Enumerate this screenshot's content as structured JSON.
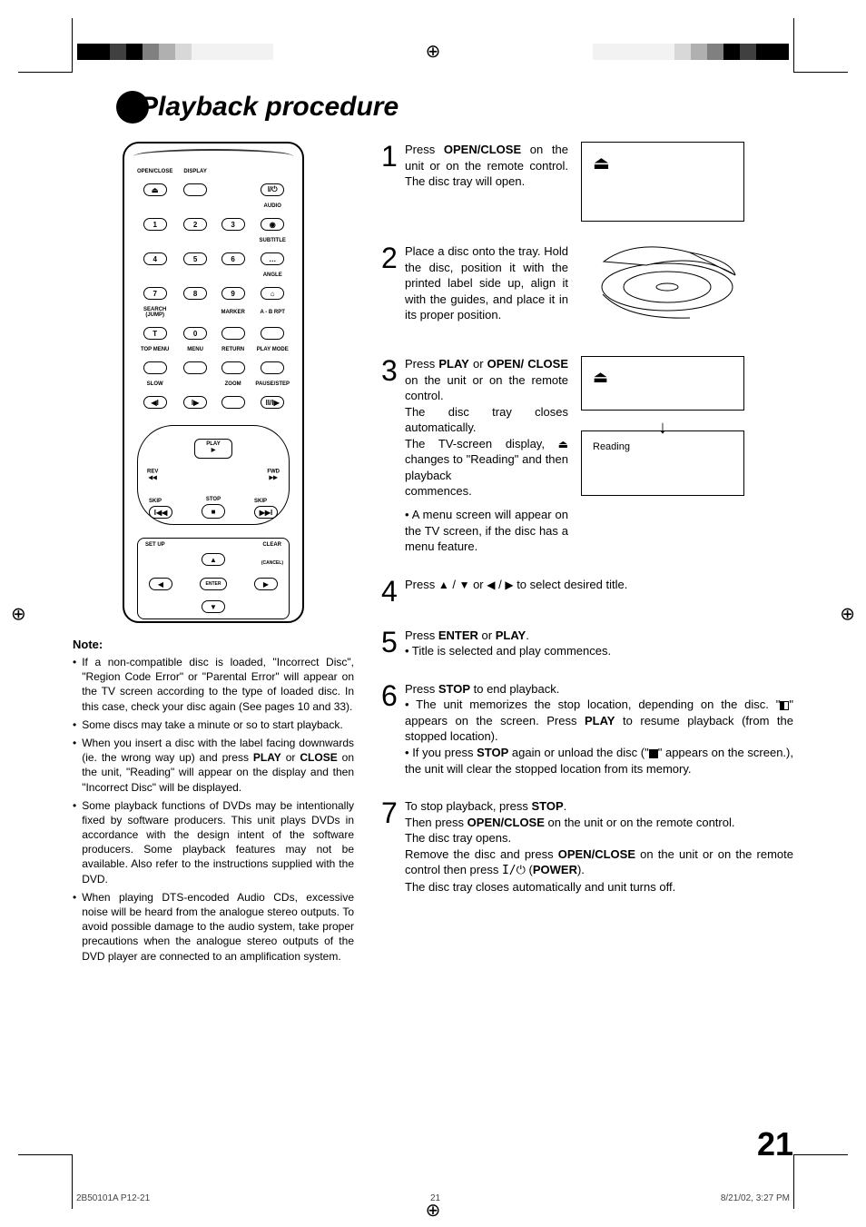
{
  "title": "Playback procedure",
  "page_number": "21",
  "footer": {
    "left": "2B50101A P12-21",
    "center": "21",
    "right": "8/21/02, 3:27 PM"
  },
  "remote": {
    "row1_labels": [
      "OPEN/CLOSE",
      "DISPLAY",
      "",
      ""
    ],
    "row2_labels": [
      "",
      "",
      "",
      "AUDIO"
    ],
    "nums_row1": [
      "1",
      "2",
      "3"
    ],
    "row3_labels": [
      "",
      "",
      "",
      "SUBTITLE"
    ],
    "nums_row2": [
      "4",
      "5",
      "6"
    ],
    "row4_labels": [
      "",
      "",
      "",
      "ANGLE"
    ],
    "nums_row3": [
      "7",
      "8",
      "9"
    ],
    "row5_labels": [
      "SEARCH (JUMP)",
      "",
      "MARKER",
      "A - B RPT"
    ],
    "nums_row4": [
      "T",
      "0"
    ],
    "row6_labels": [
      "TOP MENU",
      "MENU",
      "RETURN",
      "PLAY MODE"
    ],
    "row7_labels": [
      "SLOW",
      "",
      "ZOOM",
      "PAUSE/STEP"
    ],
    "play": "PLAY",
    "rev": "REV",
    "fwd": "FWD",
    "skip_l": "SKIP",
    "skip_r": "SKIP",
    "stop": "STOP",
    "setup": "SET UP",
    "clear": "CLEAR",
    "cancel": "(CANCEL)",
    "enter": "ENTER"
  },
  "notes_heading": "Note:",
  "notes": [
    "If a non-compatible disc is loaded, \"Incorrect Disc\", \"Region Code Error\" or \"Parental Error\" will appear on the TV screen according to the type of loaded disc. In this case, check your disc again (See pages 10 and 33).",
    "Some discs may take a minute or so to start playback.",
    "When you insert a disc with the label facing downwards (ie. the wrong way up) and press PLAY or CLOSE on the unit, \"Reading\" will appear on the display and then \"Incorrect Disc\" will be displayed.",
    "Some playback functions of DVDs may be intentionally fixed by software producers. This unit plays DVDs in accordance with the design intent of the software producers. Some playback features may not be available. Also refer to the instructions supplied with the DVD.",
    "When playing DTS-encoded Audio CDs, excessive noise will be heard from the analogue stereo outputs. To avoid possible damage to the audio system, take proper precautions when the analogue stereo outputs of the DVD player are connected to an amplification system."
  ],
  "steps": {
    "s1": "Press OPEN/CLOSE on the unit or on the remote control. The disc tray will open.",
    "s2": "Place a disc onto the tray. Hold the disc, position it with the printed label side up, align it with the guides, and place it in its proper position.",
    "s3a": "Press PLAY or OPEN/CLOSE on the unit or on the remote control.",
    "s3b": "The disc tray closes automatically.",
    "s3c": "The TV-screen display, ⏏ changes to \"Reading\" and then playback commences.",
    "s3d": "• A menu screen will appear on the TV screen, if the disc has a menu feature.",
    "s3_reading": "Reading",
    "s4": "Press ▲ / ▼ or ◀ / ▶ to select desired title.",
    "s5a": "Press ENTER or PLAY.",
    "s5b": "• Title is selected and play commences.",
    "s6a": "Press STOP to end playback.",
    "s6b": "• The unit memorizes the stop location, depending on the disc. \"HALFSTOP\" appears on the screen. Press PLAY to resume playback (from the stopped location).",
    "s6c": "• If you press STOP again or unload the disc (\"FULLSTOP\" appears on the screen.), the unit will clear the stopped location from its memory.",
    "s7a": "To stop playback, press STOP.",
    "s7b": "Then press OPEN/CLOSE on the unit or on the remote control.",
    "s7c": "The disc tray opens.",
    "s7d": "Remove the disc and press OPEN/CLOSE on the unit or on the remote control then press I/⏻ (POWER).",
    "s7e": "The disc tray closes automatically and unit turns off."
  }
}
